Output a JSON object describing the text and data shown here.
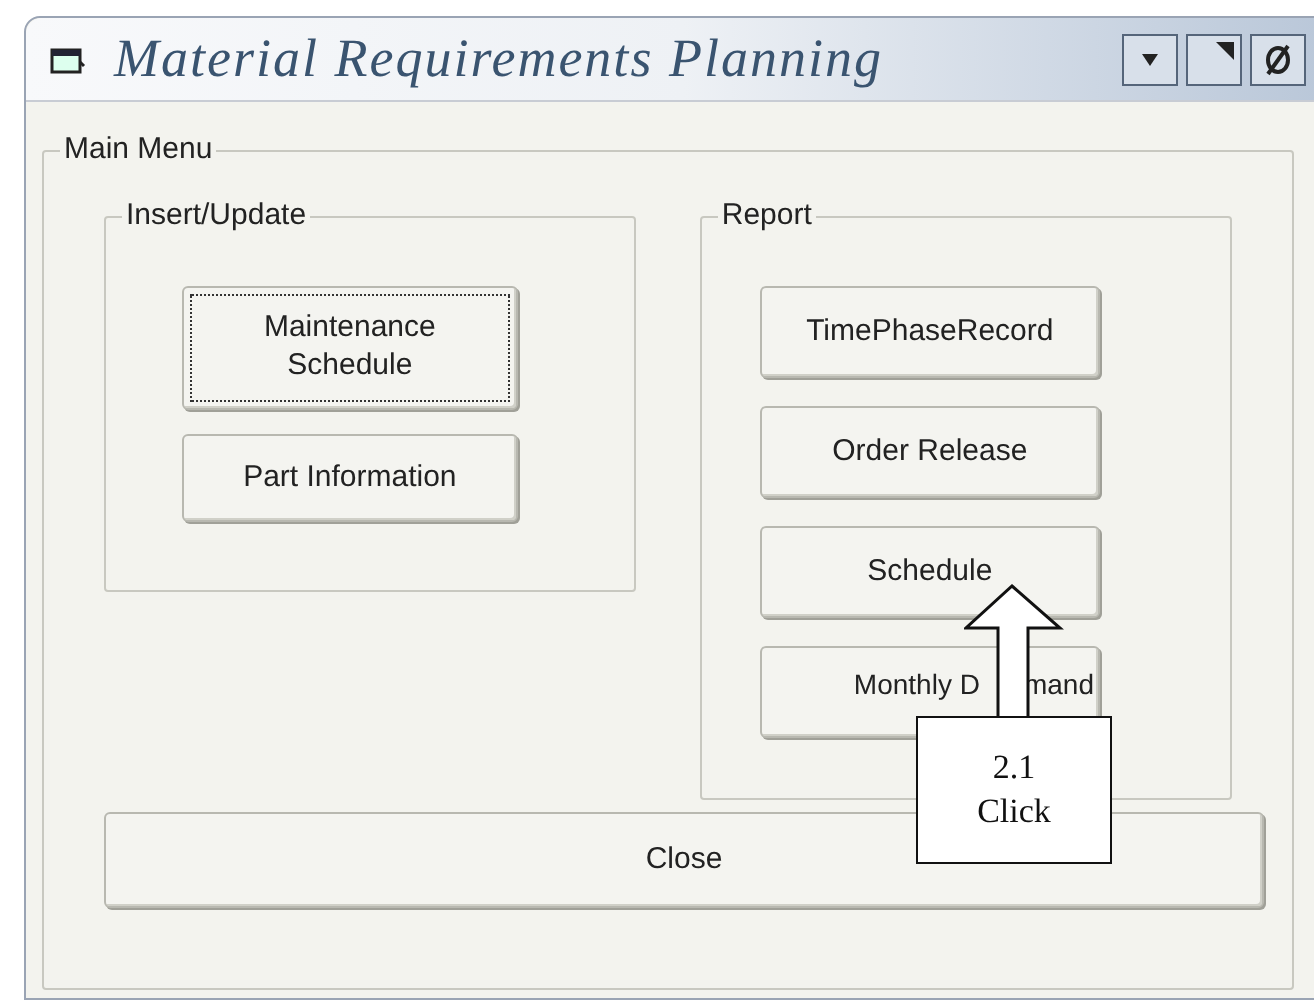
{
  "window": {
    "title": "Material Requirements Planning"
  },
  "main_menu": {
    "label": "Main Menu",
    "insert_update": {
      "label": "Insert/Update",
      "buttons": [
        {
          "label": "Maintenance Schedule",
          "focused": true
        },
        {
          "label": "Part Information",
          "focused": false
        }
      ]
    },
    "report": {
      "label": "Report",
      "buttons": [
        {
          "label": "TimePhaseRecord"
        },
        {
          "label": "Order Release"
        },
        {
          "label": "Schedule"
        },
        {
          "label_parts": [
            "Monthly D",
            "mand"
          ]
        }
      ]
    },
    "close_button": "Close"
  },
  "callout": {
    "step": "2.1",
    "text": "Click"
  }
}
